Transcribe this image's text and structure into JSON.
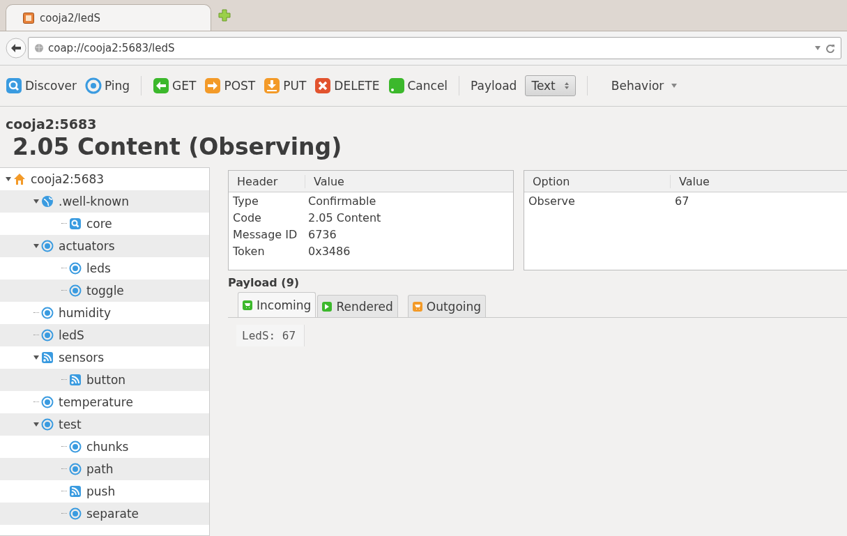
{
  "browser_tab": {
    "title": "cooja2/ledS"
  },
  "address_bar": {
    "url": "coap://cooja2:5683/ledS"
  },
  "toolbar": [
    {
      "label": "Discover",
      "kind": "search"
    },
    {
      "label": "Ping",
      "kind": "ping"
    },
    {
      "label": "GET",
      "kind": "get"
    },
    {
      "label": "POST",
      "kind": "post"
    },
    {
      "label": "PUT",
      "kind": "put"
    },
    {
      "label": "DELETE",
      "kind": "delete"
    },
    {
      "label": "Cancel",
      "kind": "cancel"
    }
  ],
  "payload_format": {
    "label": "Payload",
    "value": "Text"
  },
  "behavior": {
    "label": "Behavior"
  },
  "host": "cooja2:5683",
  "status": "2.05 Content (Observing)",
  "tree": [
    {
      "label": "cooja2:5683",
      "kind": "home",
      "expanded": true,
      "children": [
        {
          "label": ".well-known",
          "kind": "globe",
          "expanded": true,
          "children": [
            {
              "label": "core",
              "kind": "search"
            }
          ]
        },
        {
          "label": "actuators",
          "kind": "resource",
          "expanded": true,
          "children": [
            {
              "label": "leds",
              "kind": "resource"
            },
            {
              "label": "toggle",
              "kind": "resource"
            }
          ]
        },
        {
          "label": "humidity",
          "kind": "resource"
        },
        {
          "label": "ledS",
          "kind": "resource"
        },
        {
          "label": "sensors",
          "kind": "feed",
          "expanded": true,
          "children": [
            {
              "label": "button",
              "kind": "feed"
            }
          ]
        },
        {
          "label": "temperature",
          "kind": "resource"
        },
        {
          "label": "test",
          "kind": "resource",
          "expanded": true,
          "children": [
            {
              "label": "chunks",
              "kind": "resource"
            },
            {
              "label": "path",
              "kind": "resource"
            },
            {
              "label": "push",
              "kind": "feed"
            },
            {
              "label": "separate",
              "kind": "resource"
            }
          ]
        }
      ]
    }
  ],
  "headers": {
    "columns": [
      "Header",
      "Value"
    ],
    "rows": [
      [
        "Type",
        "Confirmable"
      ],
      [
        "Code",
        "2.05 Content"
      ],
      [
        "Message ID",
        "6736"
      ],
      [
        "Token",
        "0x3486"
      ]
    ]
  },
  "options": {
    "columns": [
      "Option",
      "Value"
    ],
    "rows": [
      [
        "Observe",
        "67"
      ]
    ]
  },
  "payload": {
    "title": "Payload (9)",
    "tabs": [
      {
        "label": "Incoming",
        "kind": "incoming",
        "selected": true
      },
      {
        "label": "Rendered",
        "kind": "rendered",
        "selected": false
      },
      {
        "label": "Outgoing",
        "kind": "outgoing",
        "selected": false
      }
    ],
    "content": "LedS: 67"
  }
}
